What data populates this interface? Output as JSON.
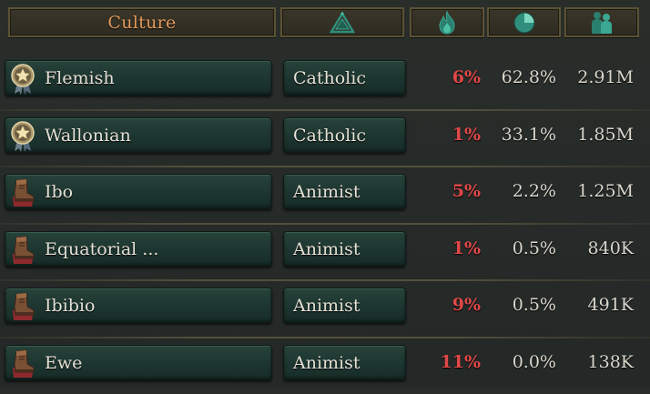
{
  "header": {
    "culture_label": "Culture",
    "religion_icon": "pyramid-icon",
    "radicals_icon": "flame-icon",
    "share_icon": "pie-chart-icon",
    "population_icon": "population-icon"
  },
  "colors": {
    "header_text": "#e39a5c",
    "radical_text": "#e04848",
    "button_green": "#1d3530"
  },
  "rows": [
    {
      "culture": "Flemish",
      "icon": "star-medal-icon",
      "religion": "Catholic",
      "radicals": "6%",
      "share": "62.8%",
      "population": "2.91M"
    },
    {
      "culture": "Wallonian",
      "icon": "star-medal-icon",
      "religion": "Catholic",
      "radicals": "1%",
      "share": "33.1%",
      "population": "1.85M"
    },
    {
      "culture": "Ibo",
      "icon": "boot-icon",
      "religion": "Animist",
      "radicals": "5%",
      "share": "2.2%",
      "population": "1.25M"
    },
    {
      "culture": "Equatorial ...",
      "icon": "boot-icon",
      "religion": "Animist",
      "radicals": "1%",
      "share": "0.5%",
      "population": "840K"
    },
    {
      "culture": "Ibibio",
      "icon": "boot-icon",
      "religion": "Animist",
      "radicals": "9%",
      "share": "0.5%",
      "population": "491K"
    },
    {
      "culture": "Ewe",
      "icon": "boot-icon",
      "religion": "Animist",
      "radicals": "11%",
      "share": "0.0%",
      "population": "138K"
    }
  ]
}
